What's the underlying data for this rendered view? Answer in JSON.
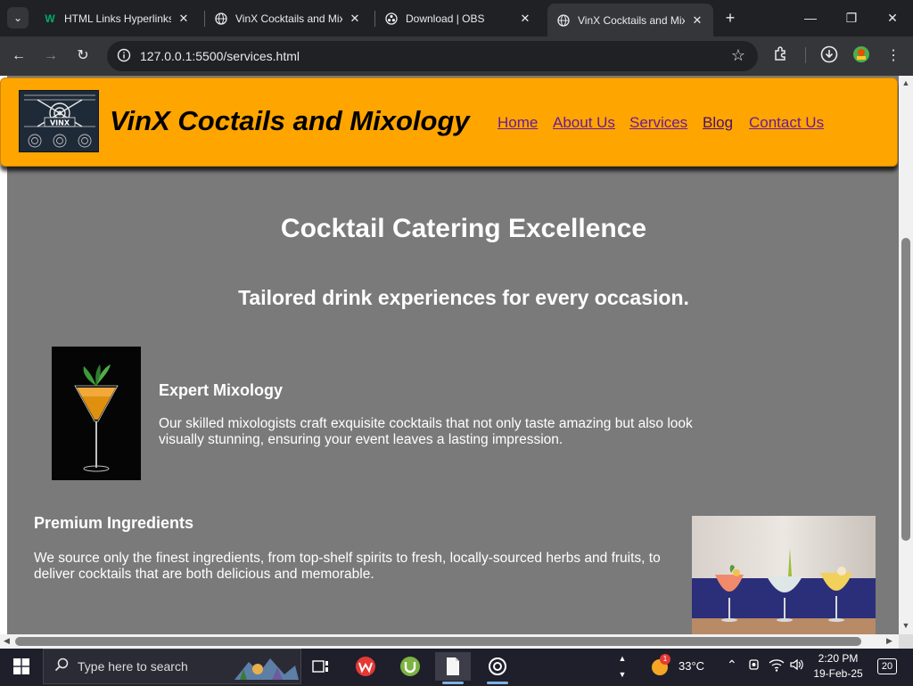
{
  "browser": {
    "tabs": [
      {
        "title": "HTML Links Hyperlinks",
        "favicon": "w3schools-icon",
        "active": false
      },
      {
        "title": "VinX Cocktails and Mix",
        "favicon": "globe-icon",
        "active": false
      },
      {
        "title": "Download | OBS",
        "favicon": "obs-icon",
        "active": false
      },
      {
        "title": "VinX Cocktails and Mix",
        "favicon": "globe-icon",
        "active": true
      }
    ],
    "new_tab": "+",
    "url": "127.0.0.1:5500/services.html",
    "window_controls": {
      "minimize": "—",
      "maximize": "❐",
      "close": "✕"
    }
  },
  "site": {
    "title": "VinX Coctails and Mixology",
    "logo_text": "VINX",
    "nav": [
      "Home",
      "About Us",
      "Services",
      "Blog",
      "Contact Us"
    ],
    "header_color": "#ffa500",
    "body_color": "#7a7a7a"
  },
  "main": {
    "heading": "Cocktail Catering Excellence",
    "subheading": "Tailored drink experiences for every occasion.",
    "services": [
      {
        "title": "Expert Mixology",
        "text": "Our skilled mixologists craft exquisite cocktails that not only taste amazing but also look visually stunning, ensuring your event leaves a lasting impression."
      },
      {
        "title": "Premium Ingredients",
        "text": "We source only the finest ingredients, from top-shelf spirits to fresh, locally-sourced herbs and fruits, to deliver cocktails that are both delicious and memorable."
      }
    ]
  },
  "taskbar": {
    "search_placeholder": "Type here to search",
    "weather": "33°C",
    "weather_badge": "1",
    "time": "2:20 PM",
    "date": "19-Feb-25",
    "notifications": "20"
  }
}
